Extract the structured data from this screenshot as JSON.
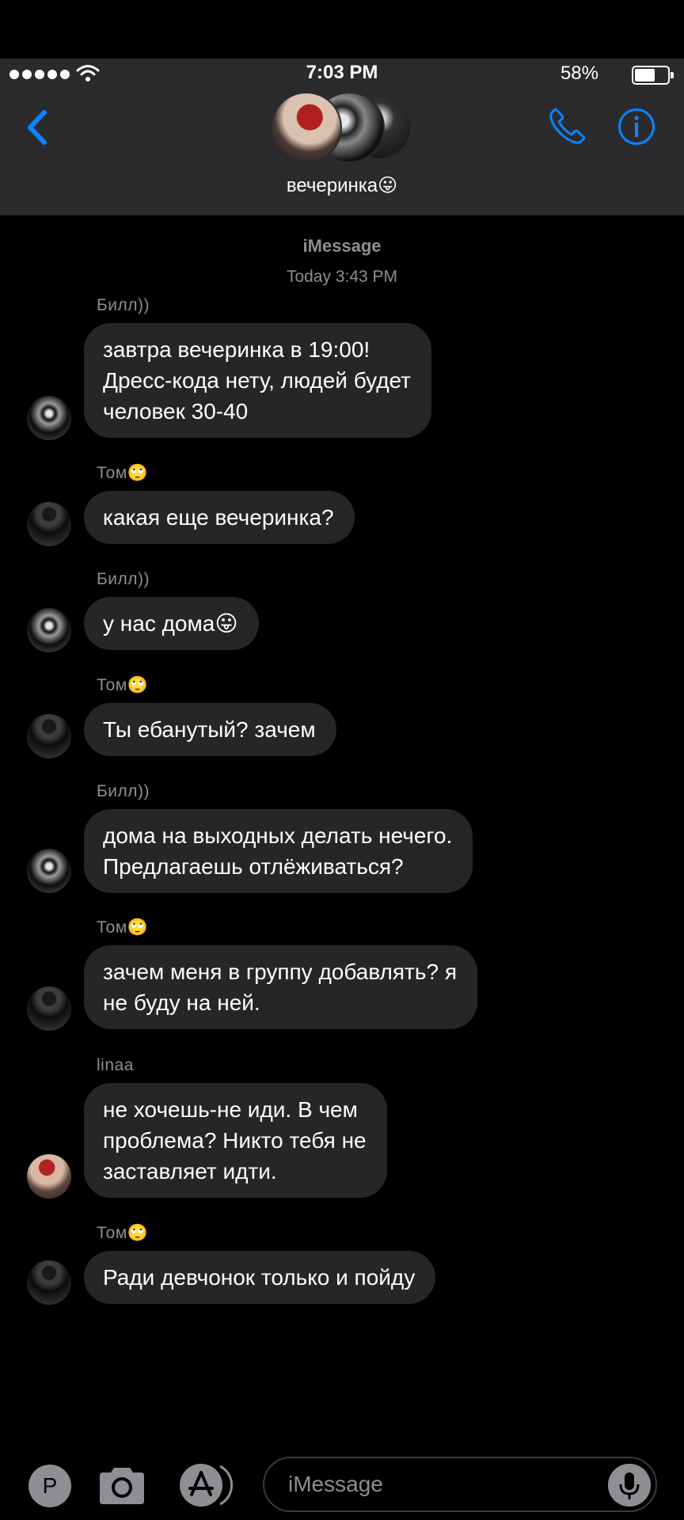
{
  "status_bar": {
    "time": "7:03 PM",
    "battery": "58%"
  },
  "conversation": {
    "title": "вечеринка😛",
    "service": "iMessage",
    "timestamp": "Today 3:43 PM"
  },
  "messages": [
    {
      "sender": "Билл))",
      "text": "завтра вечеринка  в 19:00!\nДресс-кода нету, людей будет\nчеловек 30-40"
    },
    {
      "sender": "Том🙄",
      "text": "какая еще вечеринка?"
    },
    {
      "sender": "Билл))",
      "text": "у нас дома😛"
    },
    {
      "sender": "Том🙄",
      "text": "Ты ебанутый? зачем"
    },
    {
      "sender": "Билл))",
      "text": "дома на выходных делать нечего.\nПредлагаешь отлёживаться?"
    },
    {
      "sender": "Том🙄",
      "text": "зачем меня в группу добавлять? я\nне буду на ней."
    },
    {
      "sender": "linaa",
      "text": "не хочешь-не иди. В чем\nпроблема? Никто тебя не\nзаставляет идти."
    },
    {
      "sender": "Том🙄",
      "text": "Ради девчонок только и пойду"
    }
  ],
  "input": {
    "placeholder": "iMessage",
    "app_button_label": "P"
  },
  "icons": [
    "back-chevron-icon",
    "phone-icon",
    "info-icon",
    "camera-icon",
    "app-store-icon",
    "microphone-icon",
    "wifi-icon"
  ],
  "colors": {
    "accent": "#0a84ff",
    "bubble": "#262629",
    "header": "#2b2b2d",
    "meta": "#8e8e93"
  }
}
